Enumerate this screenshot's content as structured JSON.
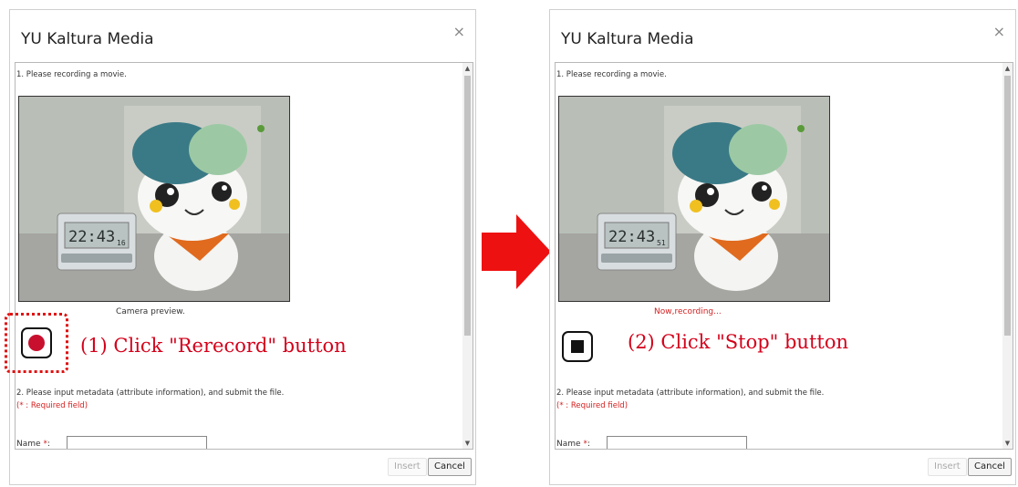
{
  "colors": {
    "annotation": "#d4001a",
    "arrow": "#ee1111",
    "record_dot": "#c8102e",
    "required_text": "#d42020"
  },
  "left_dialog": {
    "title": "YU Kaltura Media",
    "close_symbol": "×",
    "step1": "1. Please recording a movie.",
    "preview_caption": "Camera preview.",
    "clock_display": "22:43",
    "clock_seconds": "16",
    "step2": "2. Please input metadata (attribute information), and submit the file.",
    "required_note": "(* : Required field)",
    "name_label": "Name",
    "name_required": "*",
    "name_colon": ":",
    "insert_label": "Insert",
    "cancel_label": "Cancel",
    "record_button_icon": "record-dot-icon",
    "annotation": "(1) Click \"Rerecord\" button"
  },
  "right_dialog": {
    "title": "YU Kaltura Media",
    "close_symbol": "×",
    "step1": "1. Please recording a movie.",
    "recording_status": "Now,recording...",
    "clock_display": "22:43",
    "clock_seconds": "51",
    "step2": "2. Please input metadata (attribute information), and submit the file.",
    "required_note": "(* : Required field)",
    "name_label": "Name",
    "name_required": "*",
    "name_colon": ":",
    "insert_label": "Insert",
    "cancel_label": "Cancel",
    "stop_button_icon": "stop-square-icon",
    "annotation": "(2) Click \"Stop\" button"
  },
  "arrow_icon": "right-arrow-icon"
}
